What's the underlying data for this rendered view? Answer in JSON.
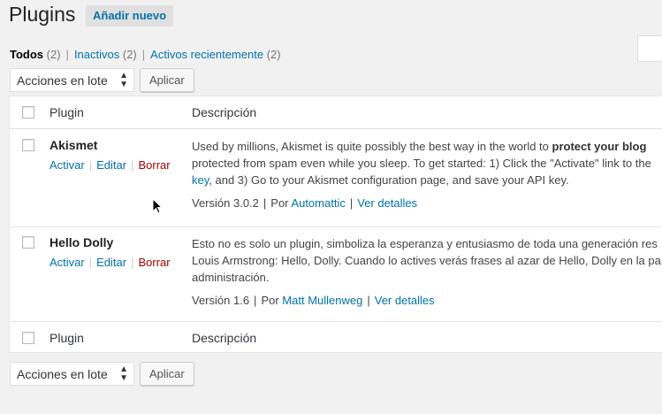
{
  "header": {
    "title": "Plugins",
    "add_new": "Añadir nuevo"
  },
  "filters": [
    {
      "label": "Todos",
      "count": "(2)"
    },
    {
      "label": "Inactivos",
      "count": "(2)"
    },
    {
      "label": "Activos recientemente",
      "count": "(2)"
    }
  ],
  "bulk": {
    "select_value": "Acciones en lote",
    "apply": "Aplicar"
  },
  "table": {
    "columns": {
      "plugin": "Plugin",
      "description": "Descripción"
    },
    "plugins": [
      {
        "name": "Akismet",
        "actions": {
          "activate": "Activar",
          "edit": "Editar",
          "delete": "Borrar"
        },
        "desc_line1": "Used by millions, Akismet is quite possibly the best way in the world to ",
        "desc_line1_bold": "protect your blog",
        "desc_line2": "protected from spam even while you sleep. To get started: 1) Click the \"Activate\" link to the",
        "desc_line3_link": "key",
        "desc_line3": ", and 3) Go to your Akismet configuration page, and save your API key.",
        "version": "Versión 3.0.2",
        "by": "Por",
        "author": "Automattic",
        "details": "Ver detalles"
      },
      {
        "name": "Hello Dolly",
        "actions": {
          "activate": "Activar",
          "edit": "Editar",
          "delete": "Borrar"
        },
        "desc_line1": "Esto no es solo un plugin, simboliza la esperanza y entusiasmo de toda una generación res",
        "desc_line2": "Louis Armstrong: Hello, Dolly. Cuando lo actives verás frases al azar de Hello, Dolly en la pa",
        "desc_line3": "administración.",
        "version": "Versión 1.6",
        "by": "Por",
        "author": "Matt Mullenweg",
        "details": "Ver detalles"
      }
    ]
  },
  "colors": {
    "link": "#0073aa",
    "delete": "#aa0000",
    "background": "#f1f1f1"
  }
}
